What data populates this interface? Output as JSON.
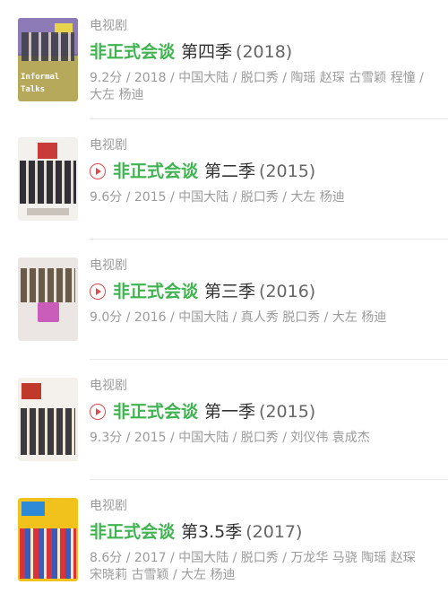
{
  "results": [
    {
      "category": "电视剧",
      "has_play": false,
      "title_main": "非正式会谈",
      "title_season": "第四季",
      "title_year": "(2018)",
      "meta": "9.2分 / 2018 / 中国大陆 / 脱口秀 / 陶瑶 赵琛 古雪颖 程憧 / 大左 杨迪",
      "poster_text_line1": "Informal",
      "poster_text_line2": "Talks"
    },
    {
      "category": "电视剧",
      "has_play": true,
      "title_main": "非正式会谈",
      "title_season": "第二季",
      "title_year": "(2015)",
      "meta": "9.6分 / 2015 / 中国大陆 / 脱口秀 / 大左 杨迪"
    },
    {
      "category": "电视剧",
      "has_play": true,
      "title_main": "非正式会谈",
      "title_season": "第三季",
      "title_year": "(2016)",
      "meta": "9.0分 / 2016 / 中国大陆 / 真人秀 脱口秀 / 大左 杨迪"
    },
    {
      "category": "电视剧",
      "has_play": true,
      "title_main": "非正式会谈",
      "title_season": "第一季",
      "title_year": "(2015)",
      "meta": "9.3分 / 2015 / 中国大陆 / 脱口秀 / 刘仪伟 袁成杰"
    },
    {
      "category": "电视剧",
      "has_play": false,
      "title_main": "非正式会谈",
      "title_season": "第3.5季",
      "title_year": "(2017)",
      "meta": "8.6分 / 2017 / 中国大陆 / 脱口秀 / 万龙华 马骁 陶瑶 赵琛 宋晓莉 古雪颖 / 大左 杨迪"
    }
  ],
  "colors": {
    "title_green": "#3fb34f",
    "play_red": "#e04a4a",
    "meta_gray": "#9b9b9b"
  }
}
